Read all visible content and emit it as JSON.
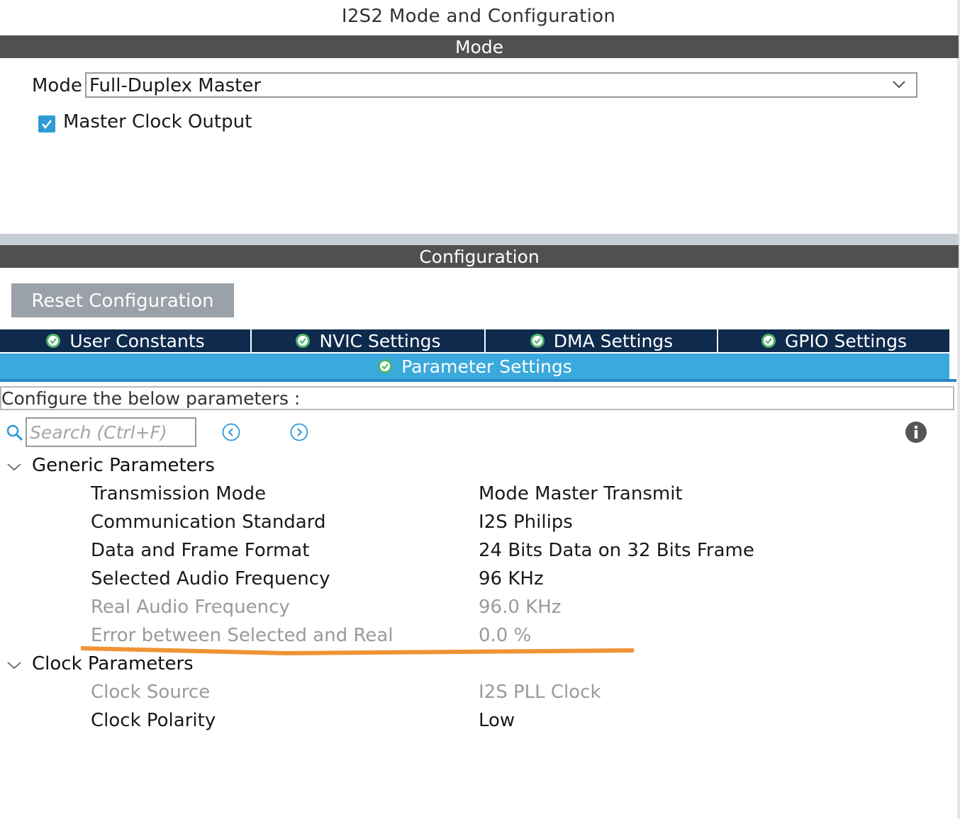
{
  "window": {
    "title": "I2S2 Mode and Configuration"
  },
  "mode_section": {
    "header": "Mode",
    "mode_label": "Mode",
    "mode_value": "Full-Duplex Master",
    "master_clock_output": {
      "label": "Master Clock Output",
      "checked": true
    }
  },
  "config_section": {
    "header": "Configuration",
    "reset_button": "Reset Configuration",
    "tabs": [
      {
        "label": "User Constants"
      },
      {
        "label": "NVIC Settings"
      },
      {
        "label": "DMA Settings"
      },
      {
        "label": "GPIO Settings"
      }
    ],
    "active_tab": {
      "label": "Parameter Settings"
    },
    "instruction": "Configure the below parameters :",
    "search": {
      "placeholder": "Search (Ctrl+F)"
    }
  },
  "parameters": {
    "generic": {
      "label": "Generic Parameters",
      "items": [
        {
          "name": "Transmission Mode",
          "value": "Mode Master Transmit",
          "enabled": true
        },
        {
          "name": "Communication Standard",
          "value": "I2S Philips",
          "enabled": true
        },
        {
          "name": "Data and Frame Format",
          "value": "24 Bits Data on 32 Bits Frame",
          "enabled": true
        },
        {
          "name": "Selected Audio Frequency",
          "value": "96 KHz",
          "enabled": true
        },
        {
          "name": "Real Audio Frequency",
          "value": "96.0 KHz",
          "enabled": false
        },
        {
          "name": "Error between Selected and Real",
          "value": "0.0 %",
          "enabled": false
        }
      ]
    },
    "clock": {
      "label": "Clock Parameters",
      "items": [
        {
          "name": "Clock Source",
          "value": "I2S PLL Clock",
          "enabled": false
        },
        {
          "name": "Clock Polarity",
          "value": "Low",
          "enabled": true
        }
      ]
    }
  },
  "colors": {
    "section_header": "#505050",
    "tab_bar": "#0e2a4d",
    "active_tab": "#3aa9dc",
    "checkbox": "#2d9ad6",
    "annotation": "#ef9434",
    "disabled_text": "#9a9a9a"
  }
}
